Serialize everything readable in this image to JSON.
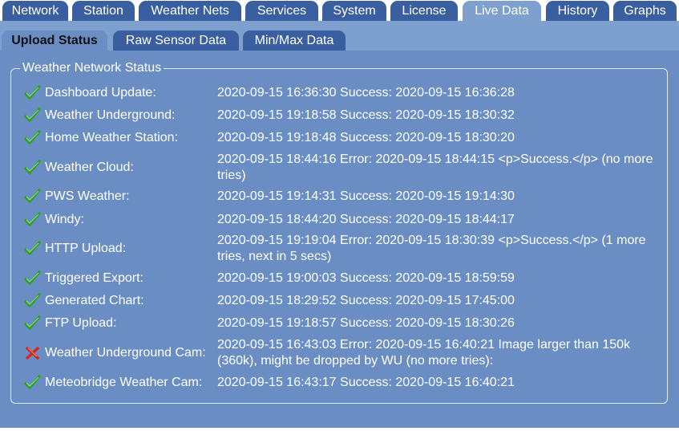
{
  "top_tabs": [
    {
      "label": "Network",
      "active": false
    },
    {
      "label": "Station",
      "active": false
    },
    {
      "label": "Weather Nets",
      "active": false
    },
    {
      "label": "Services",
      "active": false
    },
    {
      "label": "System",
      "active": false
    },
    {
      "label": "License",
      "active": false
    },
    {
      "label": "Live Data",
      "active": true
    },
    {
      "label": "History",
      "active": false
    },
    {
      "label": "Graphs",
      "active": false
    }
  ],
  "sub_tabs": [
    {
      "label": "Upload Status",
      "active": true
    },
    {
      "label": "Raw Sensor Data",
      "active": false
    },
    {
      "label": "Min/Max Data",
      "active": false
    }
  ],
  "panel": {
    "legend": "Weather Network Status",
    "rows": [
      {
        "name": "Dashboard Update:",
        "icon": "check-icon",
        "status": "2020-09-15 16:36:30 Success: 2020-09-15 16:36:28"
      },
      {
        "name": "Weather Underground:",
        "icon": "check-icon",
        "status": "2020-09-15 19:18:58 Success: 2020-09-15 18:30:32"
      },
      {
        "name": "Home Weather Station:",
        "icon": "check-icon",
        "status": "2020-09-15 19:18:48 Success: 2020-09-15 18:30:20"
      },
      {
        "name": "Weather Cloud:",
        "icon": "check-icon",
        "status": "2020-09-15 18:44:16 Error: 2020-09-15 18:44:15 <p>Success.</p> (no more tries)"
      },
      {
        "name": "PWS Weather:",
        "icon": "check-icon",
        "status": "2020-09-15 19:14:31 Success: 2020-09-15 19:14:30"
      },
      {
        "name": "Windy:",
        "icon": "check-icon",
        "status": "2020-09-15 18:44:20 Success: 2020-09-15 18:44:17"
      },
      {
        "name": "HTTP Upload:",
        "icon": "check-icon",
        "status": "2020-09-15 19:19:04 Error: 2020-09-15 18:30:39 <p>Success.</p> (1 more tries, next in 5 secs)"
      },
      {
        "name": "Triggered Export:",
        "icon": "check-icon",
        "status": "2020-09-15 19:00:03 Success: 2020-09-15 18:59:59"
      },
      {
        "name": "Generated Chart:",
        "icon": "check-icon",
        "status": "2020-09-15 18:29:52 Success: 2020-09-15 17:45:00"
      },
      {
        "name": "FTP Upload:",
        "icon": "check-icon",
        "status": "2020-09-15 19:18:57 Success: 2020-09-15 18:30:26"
      },
      {
        "name": "Weather Underground Cam:",
        "icon": "cross-icon",
        "status": "2020-09-15 16:43:03 Error: 2020-09-15 16:40:21 Image larger than 150k (360k), might be dropped by WU (no more tries):"
      },
      {
        "name": "Meteobridge Weather Cam:",
        "icon": "check-icon",
        "status": "2020-09-15 16:43:17 Success: 2020-09-15 16:40:21"
      }
    ]
  },
  "colors": {
    "tab_bg": "#3a5fa0",
    "active_tab_bg": "#7ea0cf",
    "panel_bg": "#6a8ec4",
    "check_green": "#2e9e2e",
    "cross_red": "#d42a1e"
  }
}
